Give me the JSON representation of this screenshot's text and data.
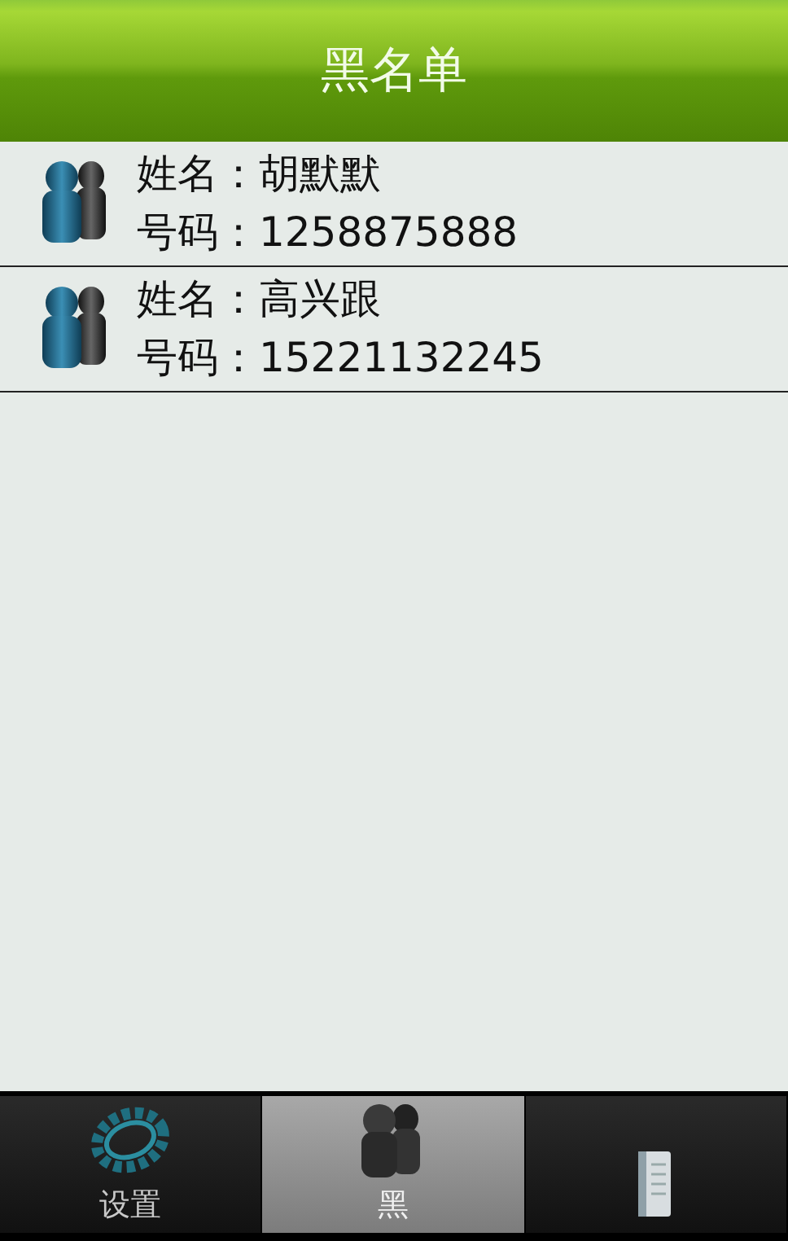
{
  "header": {
    "title": "黑名单"
  },
  "contacts": [
    {
      "name_label": "姓名：",
      "name": "胡默默",
      "number_label": "号码：",
      "number": "1258875888"
    },
    {
      "name_label": "姓名：",
      "name": "高兴跟",
      "number_label": "号码：",
      "number": "15221132245"
    }
  ],
  "tabs": [
    {
      "kind": "settings",
      "label": "设置",
      "selected": false
    },
    {
      "kind": "people",
      "label": "黑",
      "selected": true
    },
    {
      "kind": "document",
      "selected": false
    }
  ]
}
